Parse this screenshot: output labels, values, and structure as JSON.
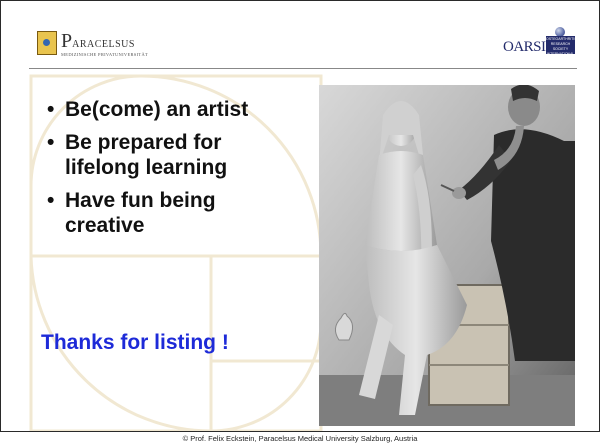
{
  "header": {
    "left_logo": {
      "name_initial": "P",
      "name_rest": "ARACELSUS",
      "subtitle": "MEDIZINISCHE PRIVATUNIVERSITÄT",
      "icon": "university-crest-icon"
    },
    "right_logo": {
      "name": "OARSI",
      "box_lines": [
        "OSTEOARTHRITIS",
        "RESEARCH SOCIETY",
        "INTERNATIONAL"
      ],
      "icon": "globe-icon",
      "brand_color": "#232b6b"
    }
  },
  "content": {
    "bullet_glyph": "•",
    "bullets": [
      [
        "Be(come) an artist"
      ],
      [
        "Be prepared for",
        "lifelong learning"
      ],
      [
        "Have fun being",
        "creative"
      ]
    ],
    "closing": "Thanks for listing !",
    "closing_color": "#1d2ad8",
    "photo_subject": "sculptor carving a seated female statue (black-and-white photo)"
  },
  "footer": {
    "text": "© Prof. Felix Eckstein, Paracelsus Medical University Salzburg, Austria"
  }
}
